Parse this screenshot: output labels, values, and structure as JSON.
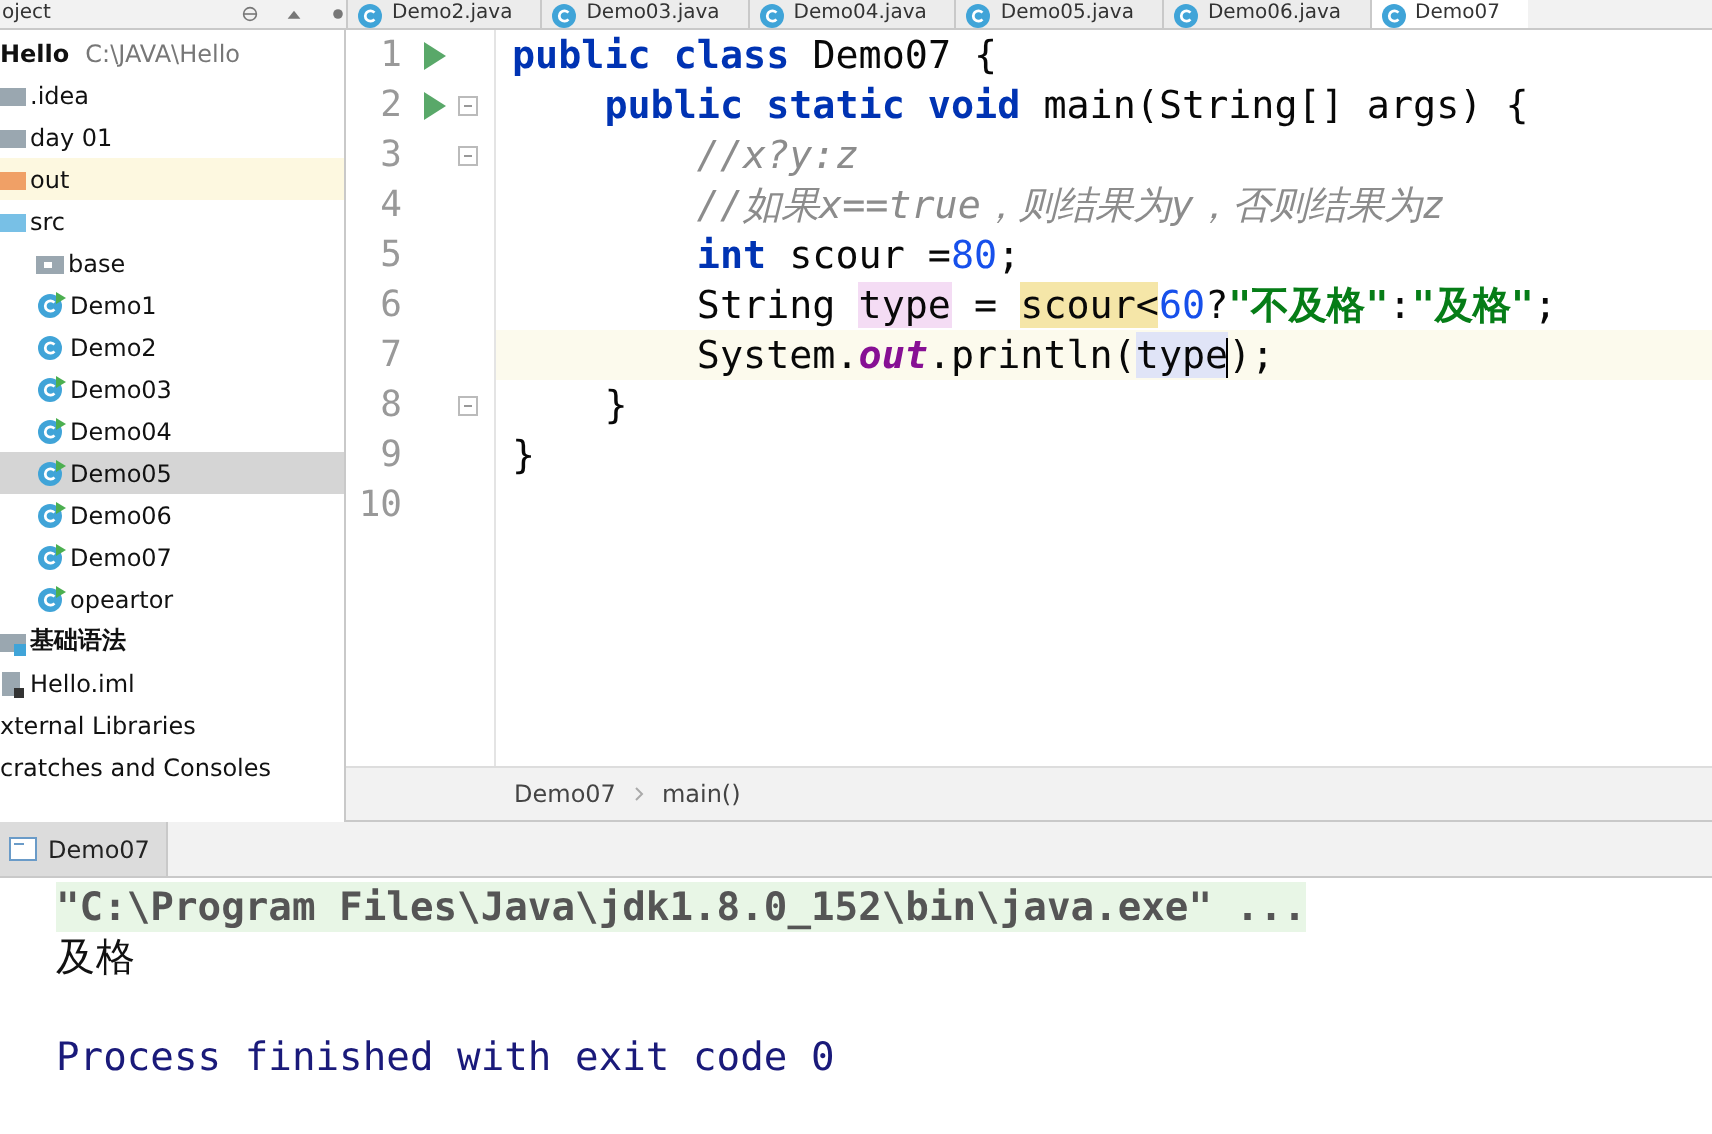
{
  "toolbar": {
    "project_label": "oject"
  },
  "editor_tabs": [
    {
      "label": "Demo2.java",
      "selected": false
    },
    {
      "label": "Demo03.java",
      "selected": false
    },
    {
      "label": "Demo04.java",
      "selected": false
    },
    {
      "label": "Demo05.java",
      "selected": false
    },
    {
      "label": "Demo06.java",
      "selected": false
    },
    {
      "label": "Demo07",
      "selected": true
    }
  ],
  "project_tree": [
    {
      "label": "Hello",
      "path": "C:\\JAVA\\Hello",
      "kind": "module",
      "selected": false,
      "children": [
        {
          "label": ".idea",
          "kind": "folder",
          "selected": false
        },
        {
          "label": "day 01",
          "kind": "folder",
          "selected": false
        },
        {
          "label": "out",
          "kind": "excluded",
          "selected": false
        },
        {
          "label": "src",
          "kind": "source",
          "selected": false,
          "children": [
            {
              "label": "base",
              "kind": "package",
              "selected": false
            },
            {
              "label": "Demo1",
              "kind": "class-run",
              "selected": false
            },
            {
              "label": "Demo2",
              "kind": "class",
              "selected": false
            },
            {
              "label": "Demo03",
              "kind": "class-run",
              "selected": false
            },
            {
              "label": "Demo04",
              "kind": "class-run",
              "selected": false
            },
            {
              "label": "Demo05",
              "kind": "class-run",
              "selected": true
            },
            {
              "label": "Demo06",
              "kind": "class-run",
              "selected": false
            },
            {
              "label": "Demo07",
              "kind": "class-run",
              "selected": false
            },
            {
              "label": "opeartor",
              "kind": "class-run",
              "selected": false
            }
          ]
        },
        {
          "label": "基础语法",
          "kind": "module",
          "selected": false
        },
        {
          "label": "Hello.iml",
          "kind": "iml",
          "selected": false
        }
      ]
    },
    {
      "label": "xternal Libraries",
      "kind": "library",
      "selected": false
    },
    {
      "label": "cratches and Consoles",
      "kind": "scratch",
      "selected": false
    }
  ],
  "code": [
    {
      "number": "1",
      "run": true,
      "fold": false,
      "current": false,
      "tokens": [
        {
          "text": "public class ",
          "kind": "keyword"
        },
        {
          "text": "Demo07 {",
          "kind": "plain"
        }
      ]
    },
    {
      "number": "2",
      "run": true,
      "fold": true,
      "current": false,
      "tokens": [
        {
          "text": "    public static void ",
          "kind": "keyword"
        },
        {
          "text": "main(String[] args) {",
          "kind": "plain"
        }
      ]
    },
    {
      "number": "3",
      "run": false,
      "fold": true,
      "current": false,
      "tokens": [
        {
          "text": "        //x?y:z",
          "kind": "comment"
        }
      ]
    },
    {
      "number": "4",
      "run": false,
      "fold": false,
      "current": false,
      "tokens": [
        {
          "text": "        //如果x==true，则结果为y，否则结果为z",
          "kind": "comment"
        }
      ]
    },
    {
      "number": "5",
      "run": false,
      "fold": false,
      "current": false,
      "tokens": [
        {
          "text": "        int ",
          "kind": "keyword"
        },
        {
          "text": "scour =",
          "kind": "plain"
        },
        {
          "text": "80",
          "kind": "number"
        },
        {
          "text": ";",
          "kind": "plain"
        }
      ]
    },
    {
      "number": "6",
      "run": false,
      "fold": false,
      "current": false,
      "tokens": [
        {
          "text": "        String ",
          "kind": "plain"
        },
        {
          "text": "type",
          "kind": "write-highlight"
        },
        {
          "text": " = ",
          "kind": "plain"
        },
        {
          "text": "scour<",
          "kind": "match-highlight"
        },
        {
          "text": "60",
          "kind": "number"
        },
        {
          "text": "?",
          "kind": "plain"
        },
        {
          "text": "\"不及格\"",
          "kind": "string"
        },
        {
          "text": ":",
          "kind": "plain"
        },
        {
          "text": "\"及格\"",
          "kind": "string"
        },
        {
          "text": ";",
          "kind": "plain"
        }
      ]
    },
    {
      "number": "7",
      "run": false,
      "fold": false,
      "current": true,
      "tokens": [
        {
          "text": "        System.",
          "kind": "plain"
        },
        {
          "text": "out",
          "kind": "field"
        },
        {
          "text": ".println(",
          "kind": "plain"
        },
        {
          "text": "type",
          "kind": "read-highlight"
        },
        {
          "text": ");",
          "kind": "plain"
        }
      ]
    },
    {
      "number": "8",
      "run": false,
      "fold": true,
      "current": false,
      "tokens": [
        {
          "text": "    }",
          "kind": "plain"
        }
      ]
    },
    {
      "number": "9",
      "run": false,
      "fold": false,
      "current": false,
      "tokens": [
        {
          "text": "}",
          "kind": "plain"
        }
      ]
    },
    {
      "number": "10",
      "run": false,
      "fold": false,
      "current": false
    }
  ],
  "breadcrumb": [
    "Demo07",
    "main()"
  ],
  "run_tabs": [
    {
      "label": "Demo07",
      "selected": true
    }
  ],
  "console": [
    {
      "text": "\"C:\\Program Files\\Java\\jdk1.8.0_152\\bin\\java.exe\" ...",
      "kind": "command"
    },
    {
      "text": "及格",
      "kind": "output"
    },
    {
      "text": "Process finished with exit code 0",
      "kind": "system"
    }
  ]
}
